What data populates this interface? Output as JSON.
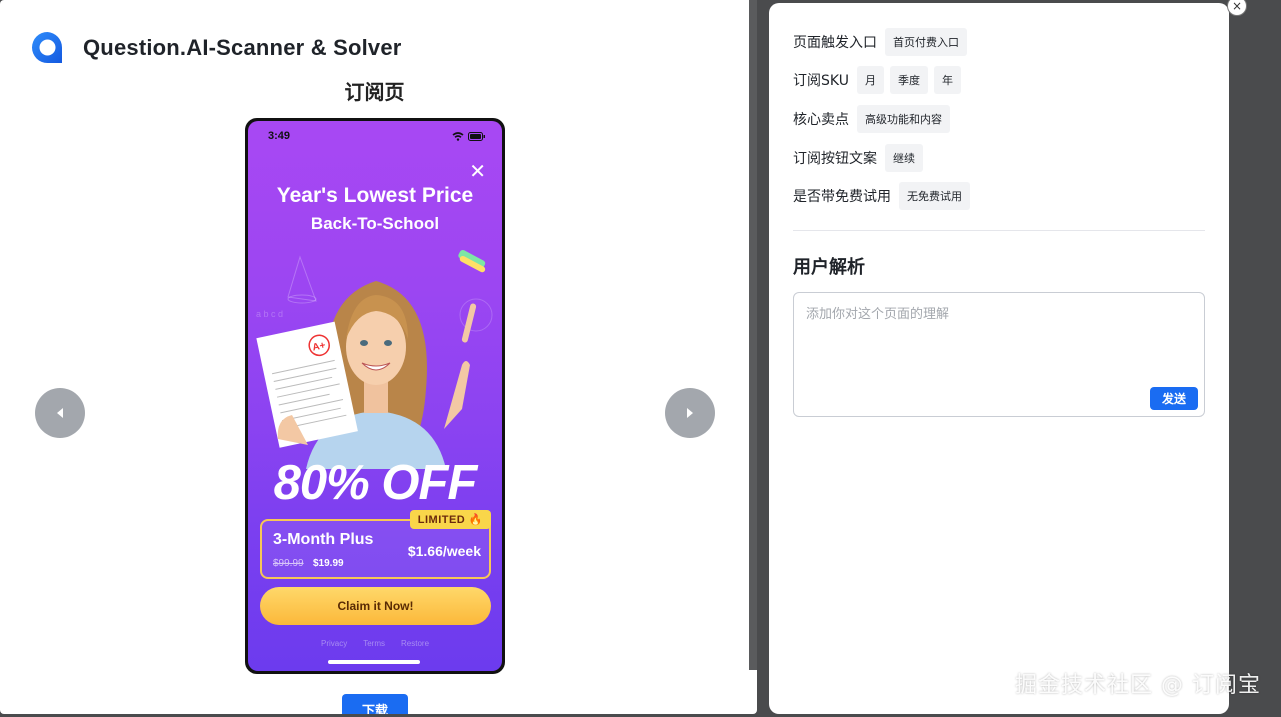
{
  "app": {
    "name": "Question.AI-Scanner & Solver",
    "logo_icon": "chat-bubble-logo-icon"
  },
  "page_title": "订阅页",
  "nav": {
    "prev_icon": "caret-left-icon",
    "next_icon": "caret-right-icon"
  },
  "phone": {
    "status_time": "3:49",
    "close_symbol": "✕",
    "title": "Year's Lowest Price",
    "subtitle": "Back-To-School",
    "discount": "80% OFF",
    "plan": {
      "badge": "LIMITED 🔥",
      "name": "3-Month Plus",
      "old_price": "$99.99",
      "new_price": "$19.99",
      "weekly": "$1.66/week"
    },
    "cta": "Claim it Now!",
    "footer_links": [
      "Privacy",
      "Terms",
      "Restore"
    ],
    "colors": {
      "bg_top": "#a848f3",
      "bg_bottom": "#6c3bee",
      "accent": "#f9d64a"
    }
  },
  "download_label": "下载",
  "attributes": [
    {
      "label": "页面触发入口",
      "tags": [
        "首页付费入口"
      ]
    },
    {
      "label": "订阅SKU",
      "tags": [
        "月",
        "季度",
        "年"
      ]
    },
    {
      "label": "核心卖点",
      "tags": [
        "高级功能和内容"
      ]
    },
    {
      "label": "订阅按钮文案",
      "tags": [
        "继续"
      ]
    },
    {
      "label": "是否带免费试用",
      "tags": [
        "无免费试用"
      ]
    }
  ],
  "analysis": {
    "title": "用户解析",
    "placeholder": "添加你对这个页面的理解",
    "value": "",
    "send_label": "发送"
  },
  "close_symbol": "×",
  "watermark": "掘金技术社区 @ 订阅宝",
  "colors": {
    "primary": "#1a6cf2",
    "backdrop": "#4a4b4d"
  }
}
